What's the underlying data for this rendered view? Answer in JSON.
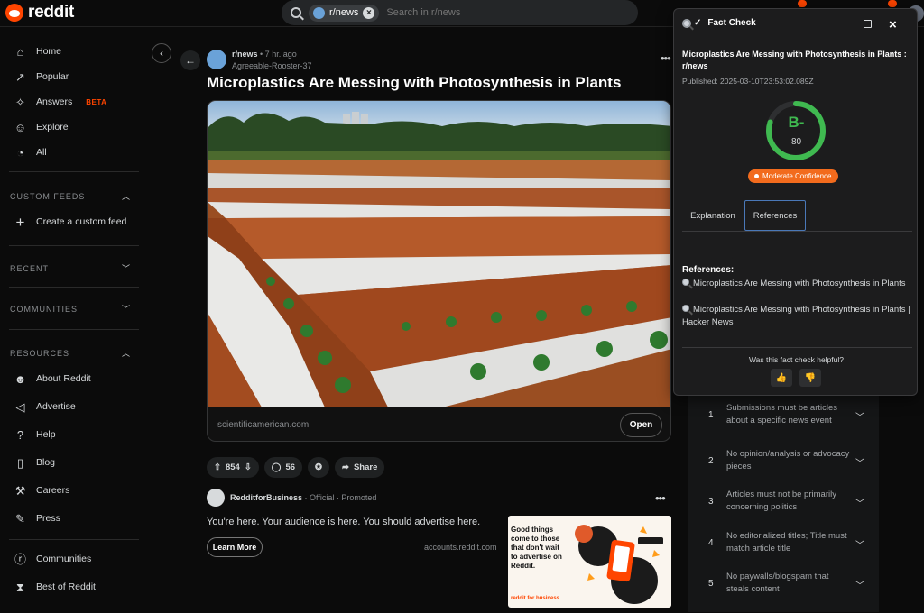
{
  "header": {
    "logo_text": "reddit",
    "search_chip": "r/news",
    "search_placeholder": "Search in r/news"
  },
  "sidebar": {
    "primary": [
      "Home",
      "Popular",
      "Answers",
      "Explore",
      "All"
    ],
    "answers_badge": "BETA",
    "custom_feeds_title": "CUSTOM FEEDS",
    "create_custom_feed": "Create a custom feed",
    "recent_title": "RECENT",
    "communities_title": "COMMUNITIES",
    "resources_title": "RESOURCES",
    "resources": [
      "About Reddit",
      "Advertise",
      "Help",
      "Blog",
      "Careers",
      "Press"
    ],
    "bottom": [
      "Communities",
      "Best of Reddit"
    ]
  },
  "post": {
    "subreddit": "r/news",
    "time": "• 7 hr. ago",
    "author": "Agreeable-Rooster-37",
    "title": "Microplastics Are Messing with Photosynthesis in Plants",
    "link_domain": "scientificamerican.com",
    "open_label": "Open",
    "upvotes": "854",
    "comments": "56",
    "share_label": "Share"
  },
  "ad": {
    "advertiser": "RedditforBusiness",
    "meta": "· Official · Promoted",
    "text": "You're here. Your audience is here. You should advertise here.",
    "cta": "Learn More",
    "domain": "accounts.reddit.com",
    "creative_headline": "Good things come to those that don't wait to advertise on Reddit.",
    "creative_brand": "reddit for business"
  },
  "rules": [
    {
      "num": "1",
      "text": "Submissions must be articles about a specific news event"
    },
    {
      "num": "2",
      "text": "No opinion/analysis or advocacy pieces"
    },
    {
      "num": "3",
      "text": "Articles must not be primarily concerning politics"
    },
    {
      "num": "4",
      "text": "No editorialized titles; Title must match article title"
    },
    {
      "num": "5",
      "text": "No paywalls/blogspam that steals content"
    }
  ],
  "fact_check": {
    "title": "Fact Check",
    "headline": "Microplastics Are Messing with Photosynthesis in Plants : r/news",
    "published": "Published: 2025-03-10T23:53:02.089Z",
    "grade": "B-",
    "score": "80",
    "score_fraction": 0.8,
    "confidence": "Moderate Confidence",
    "tabs": [
      "Explanation",
      "References"
    ],
    "active_tab": "References",
    "references_title": "References:",
    "references": [
      "Microplastics Are Messing with Photosynthesis in Plants",
      "Microplastics Are Messing with Photosynthesis in Plants | Hacker News"
    ],
    "helpful_prompt": "Was this fact check helpful?"
  },
  "colors": {
    "brand": "#ff4500",
    "gauge": "#3fb950",
    "confidence": "#f26b1d",
    "active_tab_border": "#4a78b8"
  }
}
